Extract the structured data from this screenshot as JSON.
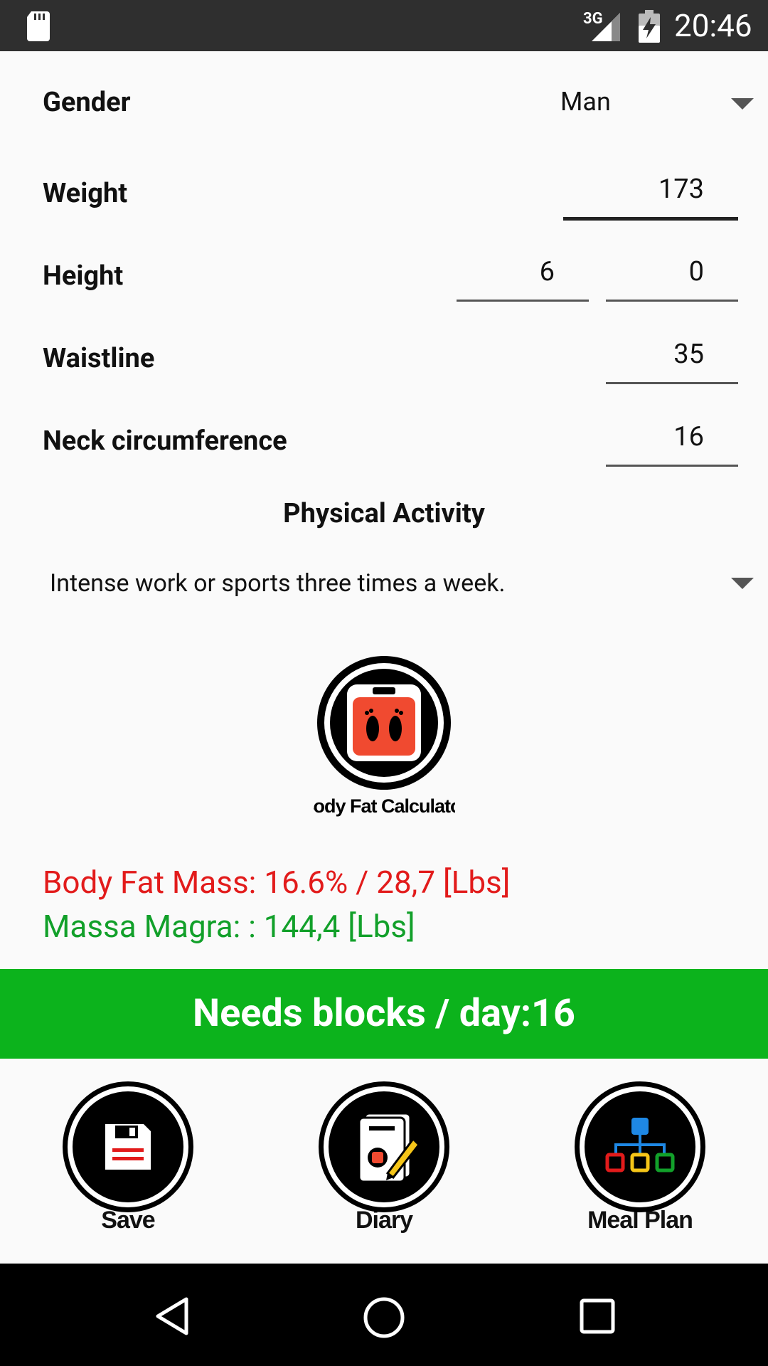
{
  "status_bar": {
    "network": "3G",
    "time": "20:46"
  },
  "form": {
    "gender_label": "Gender",
    "gender_value": "Man",
    "weight_label": "Weight",
    "weight_value": "173",
    "height_label": "Height",
    "height_feet": "6",
    "height_inches": "0",
    "waist_label": "Waistline",
    "waist_value": "35",
    "neck_label": "Neck circumference",
    "neck_value": "16"
  },
  "activity": {
    "title": "Physical Activity",
    "value": "Intense work or sports three times a week."
  },
  "logo": {
    "caption": "Body Fat Calculator"
  },
  "results": {
    "fat_mass": "Body Fat Mass: 16.6% / 28,7 [Lbs]",
    "lean_mass": "Massa Magra: : 144,4 [Lbs]",
    "fat_color": "#e21b1b",
    "lean_color": "#12a02a"
  },
  "blocks_bar": {
    "text": "Needs blocks / day:16",
    "color": "#0cb31c"
  },
  "actions": {
    "save": "Save",
    "diary": "Diary",
    "meal_plan": "Meal Plan"
  }
}
